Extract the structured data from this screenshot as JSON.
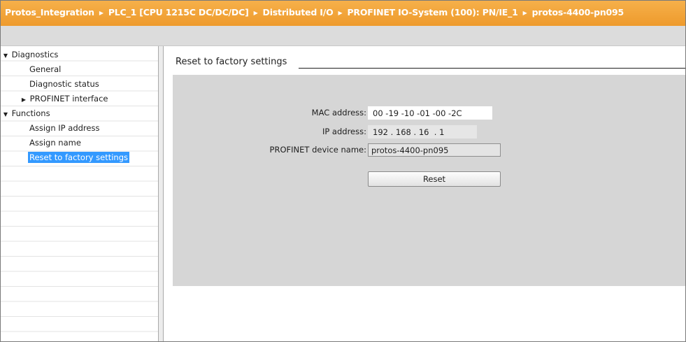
{
  "breadcrumb": [
    "Protos_Integration",
    "PLC_1 [CPU 1215C DC/DC/DC]",
    "Distributed I/O",
    "PROFINET IO-System (100): PN/IE_1",
    "protos-4400-pn095"
  ],
  "nav": {
    "items": [
      {
        "label": "Diagnostics",
        "level": 0,
        "expander": "expanded"
      },
      {
        "label": "General",
        "level": 1
      },
      {
        "label": "Diagnostic status",
        "level": 1
      },
      {
        "label": "PROFINET interface",
        "level": 1,
        "expander": "collapsed"
      },
      {
        "label": "Functions",
        "level": 0,
        "expander": "expanded"
      },
      {
        "label": "Assign IP address",
        "level": 1
      },
      {
        "label": "Assign name",
        "level": 1
      },
      {
        "label": "Reset to factory settings",
        "level": 1,
        "selected": true
      }
    ]
  },
  "section": {
    "title": "Reset to factory settings"
  },
  "form": {
    "mac_label": "MAC address:",
    "mac_value": "00 -19 -10 -01 -00 -2C",
    "ip_label": "IP address:",
    "ip_value": "192 . 168 . 16  . 1",
    "device_name_label": "PROFINET device name:",
    "device_name_value": "protos-4400-pn095",
    "reset_button": "Reset"
  },
  "colors": {
    "titlebar": "#f2a33a",
    "selection": "#3399ff",
    "panel": "#d6d6d6"
  }
}
